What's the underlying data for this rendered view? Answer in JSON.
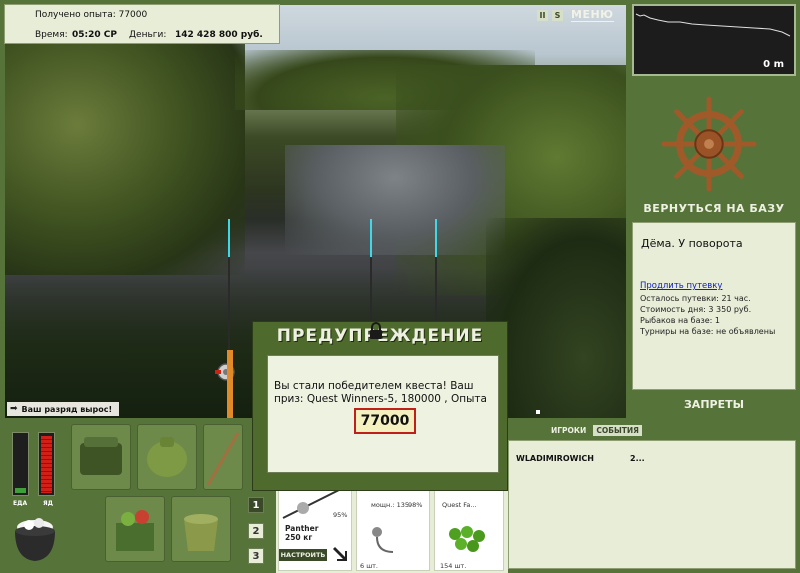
{
  "info": {
    "experience": "Получено опыта: 77000",
    "time_label": "Время:",
    "time_value": "05:20 СР",
    "money_label": "Деньги:",
    "money_value": "142 428 800 руб."
  },
  "top_controls": {
    "pause_icon": "II",
    "sound_icon": "S",
    "menu_label": "МЕНЮ"
  },
  "depth": {
    "value": "0 m"
  },
  "right_panel": {
    "return_label": "ВЕРНУТЬСЯ НА БАЗУ",
    "base_name": "Дёма. У поворота",
    "extend_link": "Продлить путевку",
    "remaining": "Осталось путевки: 21 час.",
    "day_cost": "Стоимость дня: 3 350 руб.",
    "fishers": "Рыбаков на базе: 1",
    "tournaments": "Турниры на базе: не объявлены",
    "bans_label": "ЗАПРЕТЫ"
  },
  "players": {
    "tab_players": "ИГРОКИ",
    "tab_events": "СОБЫТИЯ",
    "row_name": "WLADIMIROWICH",
    "row_value": "2..."
  },
  "notice": {
    "rank_up": "Ваш разряд вырос!"
  },
  "meters": {
    "food_label": "ЕДА",
    "poison_label": "ЯД",
    "food_level": 0.08,
    "poison_level": 0.95
  },
  "rig_panel": {
    "pages": [
      "1",
      "2",
      "3"
    ],
    "rod_name": "Panther",
    "rod_weight": "250 кг",
    "setup_label": "НАСТРОИТЬ",
    "percent_1": "95%",
    "power_label": "мощн.: 135",
    "percent_2": "98%",
    "quest_label": "Quest Fa...",
    "count_1": "6 шт.",
    "count_2": "154 шт."
  },
  "dialog": {
    "title": "ПРЕДУПРЕЖДЕНИЕ",
    "text": "Вы стали победителем квеста! Ваш приз: Quest Winners-5, 180000 , Опыта",
    "value": "77000"
  },
  "colors": {
    "panel_green": "#56733a",
    "panel_light": "#e8edd8",
    "rod_tip": "#3fd8e8",
    "highlight_red": "#c0201a"
  }
}
